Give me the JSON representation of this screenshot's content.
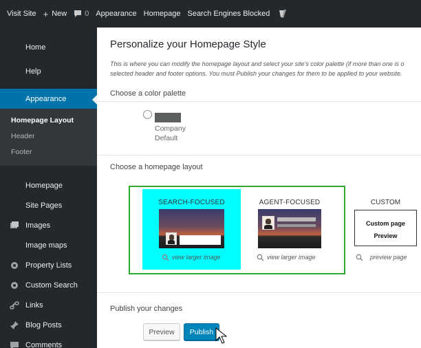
{
  "adminbar": {
    "visit_site": "Visit Site",
    "new": "New",
    "comments_count": "0",
    "appearance": "Appearance",
    "homepage": "Homepage",
    "search_engines": "Search Engines Blocked"
  },
  "sidebar": {
    "top_items": [
      "Home",
      "Help"
    ],
    "appearance": "Appearance",
    "submenu": [
      "Homepage Layout",
      "Header",
      "Footer"
    ],
    "items": [
      "Homepage",
      "Site Pages",
      "Images",
      "Image maps",
      "Property Lists",
      "Custom Search",
      "Links",
      "Blog Posts",
      "Comments"
    ]
  },
  "main": {
    "title": "Personalize your Homepage Style",
    "intro_line1": "This is where you can modify the homepage layout and select your site's color palette (if more than one is o",
    "intro_line2": "selected header and footer options. You must Publish your changes for them to be applied to your website.",
    "palette_label": "Choose a color palette",
    "palette_name": "Company Default",
    "palette_color": "#5b5f60",
    "layout_label": "Choose a homepage layout",
    "layouts": [
      {
        "title": "SEARCH-FOCUSED",
        "link": "view larger image",
        "selected": true
      },
      {
        "title": "AGENT-FOCUSED",
        "link": "view larger image",
        "selected": false
      },
      {
        "title": "CUSTOM",
        "link": "preview page",
        "selected": false
      }
    ],
    "custom_line1": "Custom page",
    "custom_line2": "Preview",
    "publish_label": "Publish your changes",
    "preview_button": "Preview",
    "publish_button": "Publish"
  },
  "colors": {
    "admin_dark": "#23282d",
    "accent_blue": "#0073aa",
    "selected_layout": "#00ffff",
    "layout_border": "#2ea82e"
  }
}
